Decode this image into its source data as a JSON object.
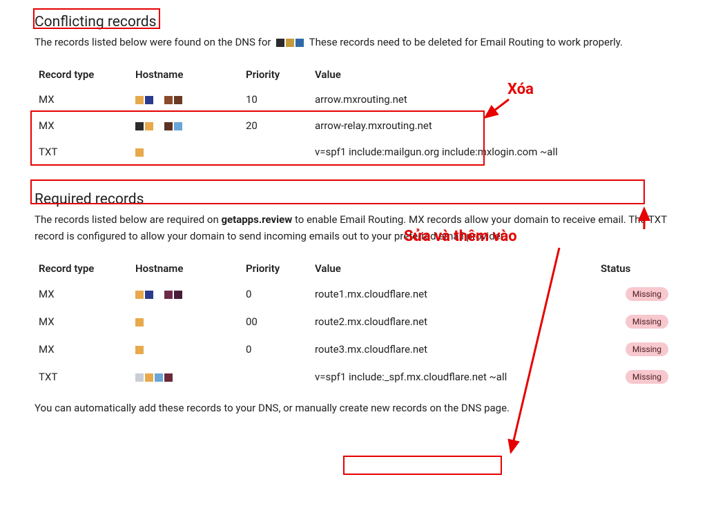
{
  "conflicting": {
    "heading": "Conflicting records",
    "desc_pre": "The records listed below were found on the DNS for",
    "desc_post": "These records need to be deleted for Email Routing to work properly.",
    "headers": {
      "type": "Record type",
      "host": "Hostname",
      "pri": "Priority",
      "val": "Value"
    },
    "rows": [
      {
        "type": "MX",
        "pri": "10",
        "val": "arrow.mxrouting.net",
        "colors": [
          "#e7a94b",
          "#2b3a8c",
          "",
          "#8a4a2b",
          "#6b3a24"
        ]
      },
      {
        "type": "MX",
        "pri": "20",
        "val": "arrow-relay.mxrouting.net",
        "colors": [
          "#2b2b2b",
          "#e7a94b",
          "",
          "#5a3324",
          "#6aa6d8"
        ]
      },
      {
        "type": "TXT",
        "pri": "",
        "val": "v=spf1 include:mailgun.org include:mxlogin.com ~all",
        "colors": [
          "#e7a94b"
        ]
      }
    ]
  },
  "required": {
    "heading": "Required records",
    "desc_a": "The records listed below are required on ",
    "desc_bold": "getapps.review",
    "desc_b": " to enable Email Routing. MX records allow your domain to receive email. The TXT record is configured to allow your domain to send incoming emails out to your preferred email provider.",
    "headers": {
      "type": "Record type",
      "host": "Hostname",
      "pri": "Priority",
      "val": "Value",
      "status": "Status"
    },
    "status_missing": "Missing",
    "rows": [
      {
        "type": "MX",
        "pri": "0",
        "val": "route1.mx.cloudflare.net",
        "colors": [
          "#e7a94b",
          "#2b3a8c",
          "",
          "#6b2a4a",
          "#4a1a3a"
        ]
      },
      {
        "type": "MX",
        "pri": "00",
        "val": "route2.mx.cloudflare.net",
        "colors": [
          "#e7a94b"
        ]
      },
      {
        "type": "MX",
        "pri": "0",
        "val": "route3.mx.cloudflare.net",
        "colors": [
          "#e7a94b"
        ]
      },
      {
        "type": "TXT",
        "pri": "",
        "val": "v=spf1 include:_spf.mx.cloudflare.net ~all",
        "colors": [
          "#c9cfd4",
          "#e7a94b",
          "#6aa6d8",
          "#6b2a3a",
          ""
        ]
      }
    ],
    "footnote": "You can automatically add these records to your DNS, or manually create new records on the DNS page."
  },
  "annotations": {
    "xoa": "Xóa",
    "sua": "Sửa và thêm vào"
  }
}
